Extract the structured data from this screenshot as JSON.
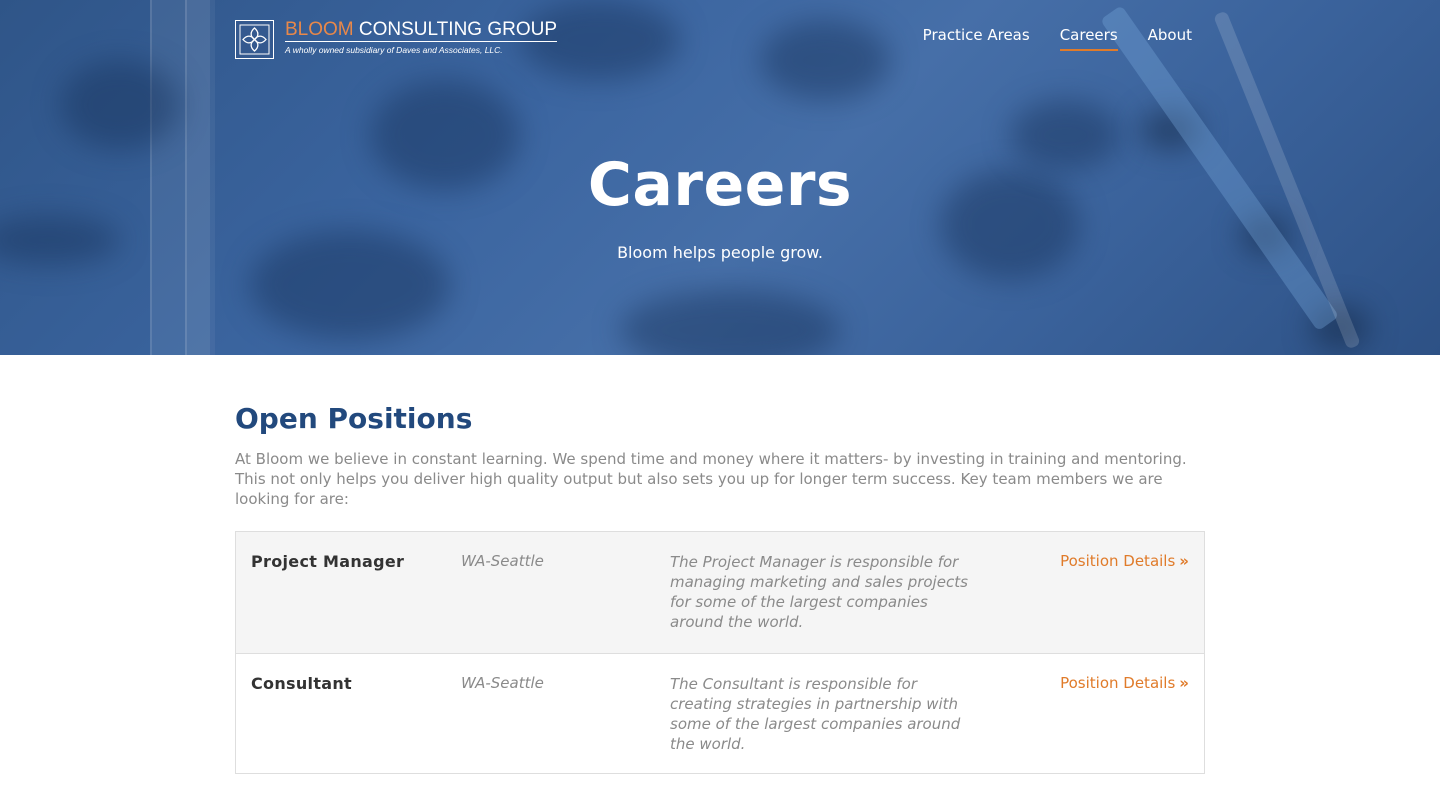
{
  "header": {
    "brand": {
      "name_accent": "BLOOM",
      "name_rest": "CONSULTING GROUP",
      "tagline": "A wholly owned subsidiary of Daves and Associates, LLC."
    },
    "nav": [
      {
        "label": "Practice Areas",
        "active": false
      },
      {
        "label": "Careers",
        "active": true
      },
      {
        "label": "About",
        "active": false
      }
    ]
  },
  "hero": {
    "title": "Careers",
    "subtitle": "Bloom helps people grow."
  },
  "main": {
    "section_title": "Open Positions",
    "intro": "At Bloom we believe in constant learning. We spend time and money where it matters- by investing in training and mentoring. This not only helps you deliver high quality output but also sets you up for longer term success. Key team members we are looking for are:",
    "positions": [
      {
        "title": "Project Manager",
        "location": "WA-Seattle",
        "description": "The Project Manager is responsible for managing marketing and sales projects for some of the largest companies around the world.",
        "link_label": "Position Details"
      },
      {
        "title": "Consultant",
        "location": "WA-Seattle",
        "description": "The Consultant is responsible for creating strategies in partnership with some of the largest companies around the world.",
        "link_label": "Position Details"
      }
    ]
  },
  "colors": {
    "brand_blue": "#22497d",
    "accent_orange": "#e07b2a",
    "hero_blue": "#3b65a0"
  }
}
